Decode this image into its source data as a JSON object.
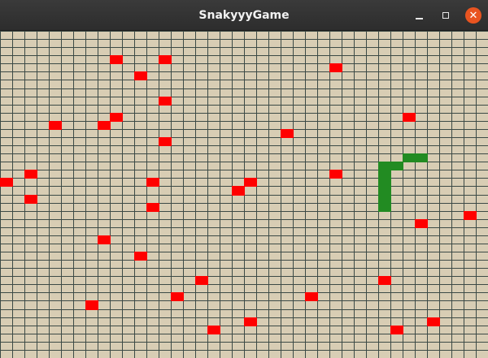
{
  "window": {
    "title": "SnakyyyGame",
    "controls": {
      "minimize_icon": "minimize-icon",
      "maximize_icon": "maximize-icon",
      "close_icon": "close-icon",
      "close_glyph": "✕"
    }
  },
  "game": {
    "colors": {
      "background": "#d8cdb4",
      "grid_line": "#3c4a46",
      "food": "#ff0000",
      "snake": "#228b22",
      "close_button": "#e95420"
    },
    "grid": {
      "cols": 40,
      "rows": 40
    },
    "snake": [
      [
        34,
        15
      ],
      [
        33,
        15
      ],
      [
        32,
        16
      ],
      [
        31,
        16
      ],
      [
        31,
        17
      ],
      [
        31,
        18
      ],
      [
        31,
        19
      ],
      [
        31,
        20
      ],
      [
        31,
        21
      ]
    ],
    "food": [
      [
        9,
        3
      ],
      [
        13,
        3
      ],
      [
        11,
        5
      ],
      [
        27,
        4
      ],
      [
        13,
        8
      ],
      [
        33,
        10
      ],
      [
        9,
        10
      ],
      [
        4,
        11
      ],
      [
        8,
        11
      ],
      [
        23,
        12
      ],
      [
        13,
        13
      ],
      [
        2,
        17
      ],
      [
        27,
        17
      ],
      [
        0,
        18
      ],
      [
        12,
        18
      ],
      [
        20,
        18
      ],
      [
        19,
        19
      ],
      [
        2,
        20
      ],
      [
        12,
        21
      ],
      [
        38,
        22
      ],
      [
        34,
        23
      ],
      [
        8,
        25
      ],
      [
        11,
        27
      ],
      [
        16,
        30
      ],
      [
        31,
        30
      ],
      [
        14,
        32
      ],
      [
        25,
        32
      ],
      [
        7,
        33
      ],
      [
        20,
        35
      ],
      [
        35,
        35
      ],
      [
        17,
        36
      ],
      [
        32,
        36
      ]
    ]
  }
}
